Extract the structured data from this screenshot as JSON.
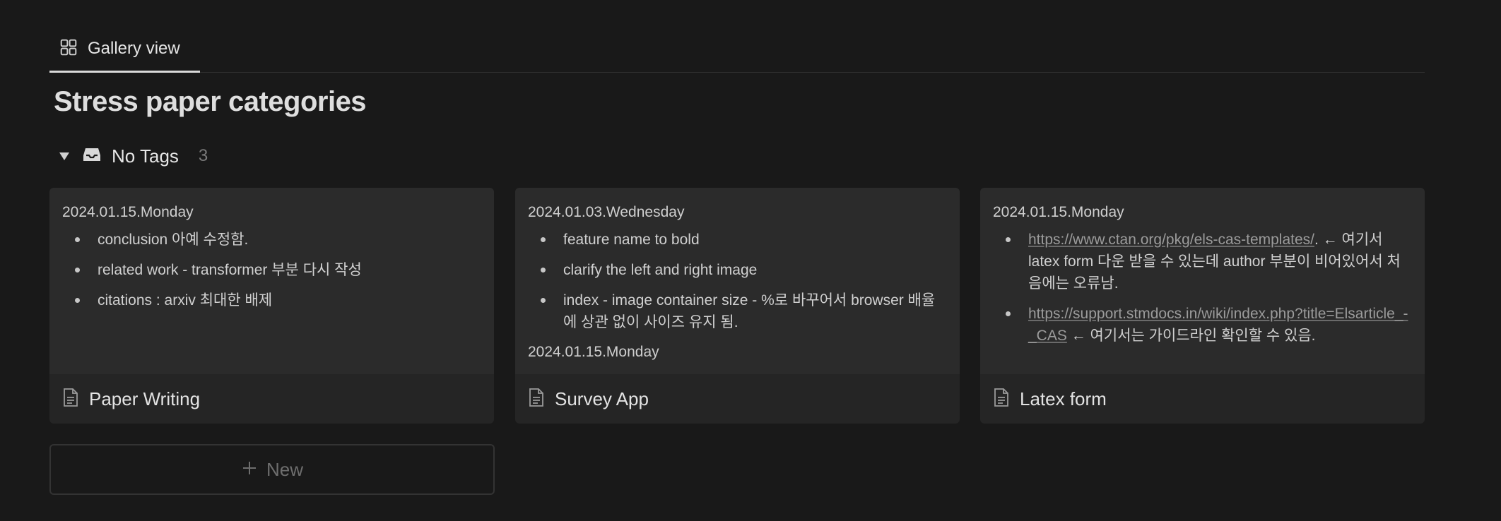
{
  "view_tab": {
    "label": "Gallery view",
    "icon": "grid-icon"
  },
  "page": {
    "title": "Stress paper categories"
  },
  "group": {
    "label": "No Tags",
    "count": "3",
    "icon": "inbox-icon"
  },
  "cards": [
    {
      "title": "Paper Writing",
      "date": "2024.01.15.Monday",
      "bullets": [
        "conclusion 아예 수정함.",
        "related work - transformer 부분 다시 작성",
        "citations : arxiv 최대한 배제"
      ]
    },
    {
      "title": "Survey App",
      "date": "2024.01.03.Wednesday",
      "bullets": [
        "feature name to bold",
        "clarify the left and right image",
        "index - image container size - %로 바꾸어서 browser 배율에 상관 없이 사이즈 유지 됨."
      ],
      "date2": "2024.01.15.Monday"
    },
    {
      "title": "Latex form",
      "date": "2024.01.15.Monday",
      "bullets": [
        {
          "link": "https://www.ctan.org/pkg/els-cas-templates/",
          "text": ". ← 여기서 latex form 다운 받을 수 있는데 author 부분이 비어있어서 처음에는 오류남."
        },
        {
          "link": "https://support.stmdocs.in/wiki/index.php?title=Elsarticle_-_CAS",
          "text": " ← 여기서는 가이드라인 확인할 수 있음."
        }
      ]
    }
  ],
  "new_button": {
    "label": "New"
  },
  "colors": {
    "background": "#191919",
    "card": "#252525",
    "card_preview": "#2b2b2b"
  }
}
